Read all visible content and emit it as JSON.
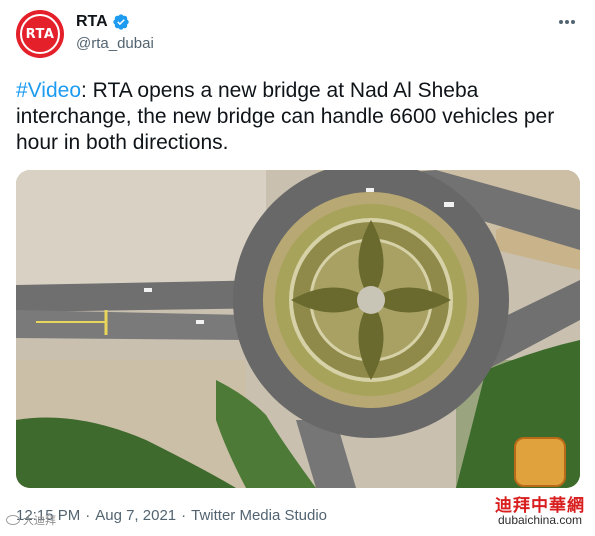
{
  "account": {
    "avatar_text": "RTA",
    "display_name": "RTA",
    "handle": "@rta_dubai",
    "brand_color": "#e4202a",
    "verified_icon": "verified-badge-icon",
    "more_icon": "more-options-icon"
  },
  "tweet": {
    "hashtag": "#Video",
    "text": ": RTA opens a new bridge at Nad Al Sheba interchange, the new bridge can handle 6600 vehicles per hour in both directions.",
    "hashtag_color": "#1d9bf0"
  },
  "media": {
    "type": "aerial-roundabout-image"
  },
  "meta": {
    "time": "12:15 PM",
    "separator1": "·",
    "date": "Aug 7, 2021",
    "separator2": "·",
    "source": "Twitter Media Studio"
  },
  "watermarks": {
    "left_text": "大迪拜",
    "right_cn": "迪拜中華網",
    "right_domain": "dubaichina.com"
  }
}
